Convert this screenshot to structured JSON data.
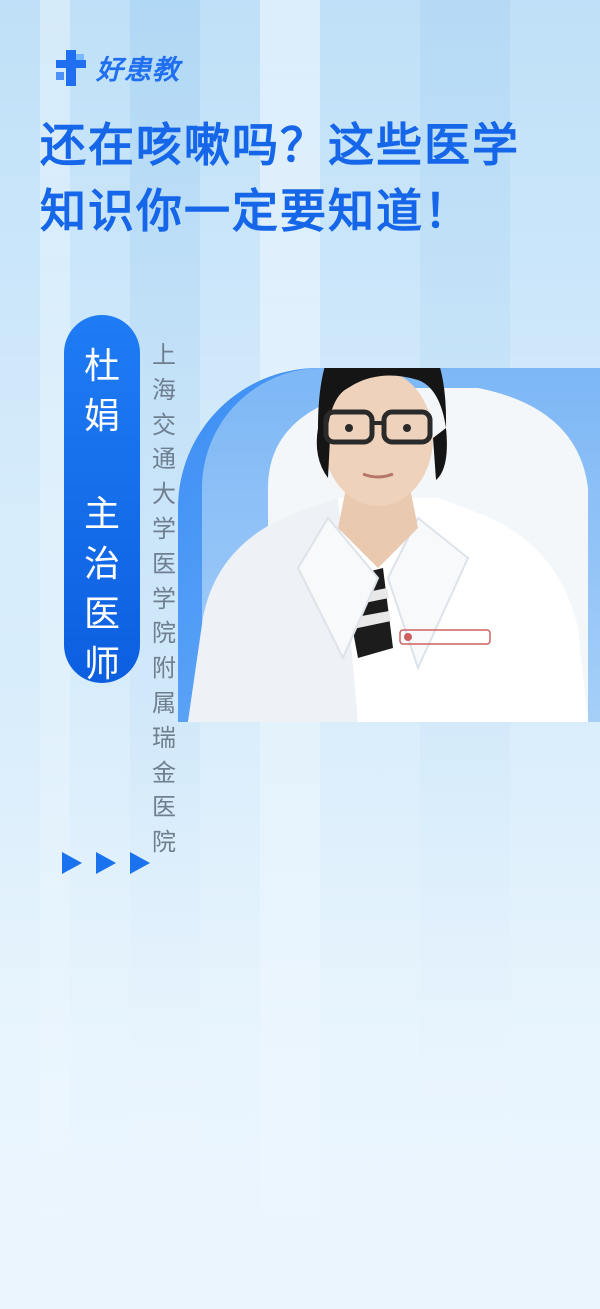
{
  "brand": {
    "name": "好患教",
    "icon": "cross-logo-icon",
    "color": "#1f6ff0"
  },
  "headline": {
    "line1": "还在咳嗽吗？这些医学",
    "line2": "知识你一定要知道！",
    "color": "#1566e8"
  },
  "doctor": {
    "name_chars": [
      "杜",
      "娟"
    ],
    "title_chars": [
      "主",
      "治",
      "医",
      "师"
    ],
    "pill_color": "#0c5fe0"
  },
  "hospital": {
    "chars": [
      "上",
      "海",
      "交",
      "通",
      "大",
      "学",
      "医",
      "学",
      "院",
      "附",
      "属",
      "瑞",
      "金",
      "医",
      "院"
    ]
  },
  "decor": {
    "arrow_icon": "play-arrow-icon",
    "arrow_count": 3
  }
}
